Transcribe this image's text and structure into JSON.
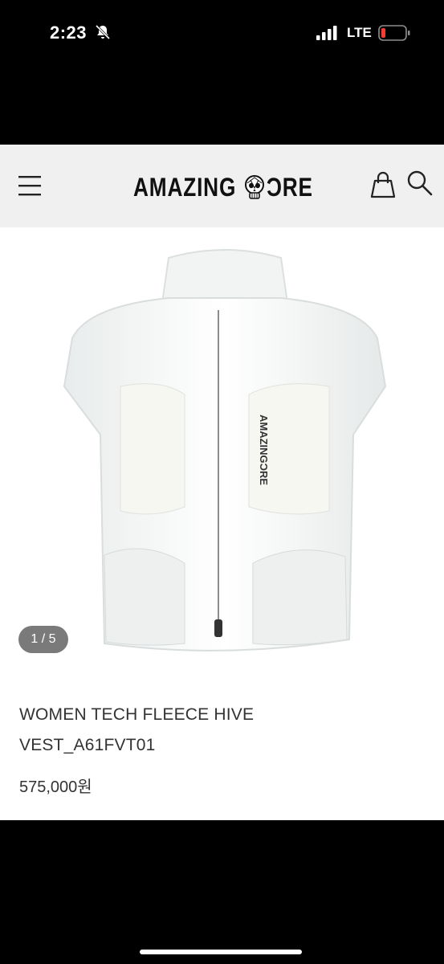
{
  "status_bar": {
    "time": "2:23",
    "network": "LTE",
    "battery_color": "#ff3b30"
  },
  "header": {
    "logo_left": "AMAZING",
    "logo_right": "ƆRE",
    "menu_icon": "hamburger-menu-icon",
    "bag_icon": "shopping-bag-icon",
    "search_icon": "search-icon",
    "background": "#f0f0f0"
  },
  "product": {
    "image_counter": "1 / 5",
    "image_brand_print": "AMAZINGƆRE",
    "name": "WOMEN TECH FLEECE HIVE VEST_A61FVT01",
    "price": "575,000원"
  }
}
